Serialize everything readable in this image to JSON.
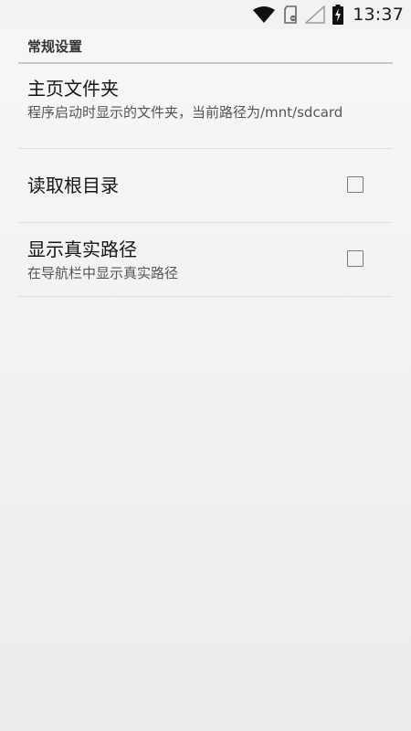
{
  "status_bar": {
    "time": "13:37",
    "icons": [
      "wifi-icon",
      "sd-card-icon",
      "cell-signal-icon",
      "battery-charging-icon"
    ]
  },
  "settings": {
    "section_title": "常规设置",
    "items": [
      {
        "title": "主页文件夹",
        "summary": "程序启动时显示的文件夹，当前路径为/mnt/sdcard"
      },
      {
        "title": "读取根目录",
        "checked": false
      },
      {
        "title": "显示真实路径",
        "summary": "在导航栏中显示真实路径",
        "checked": false
      }
    ]
  }
}
